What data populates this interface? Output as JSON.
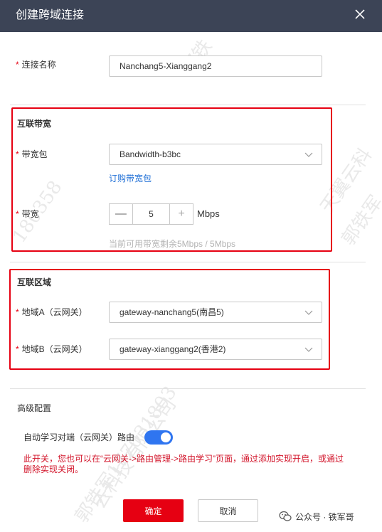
{
  "dialog": {
    "title": "创建跨域连接"
  },
  "connection_name": {
    "label": "连接名称",
    "value": "Nanchang5-Xianggang2"
  },
  "bandwidth_section": {
    "title": "互联带宽",
    "package_label": "带宽包",
    "package_value": "Bandwidth-b3bc",
    "buy_link": "订购带宽包",
    "bandwidth_label": "带宽",
    "minus": "—",
    "plus": "+",
    "bandwidth_value": "5",
    "unit": "Mbps",
    "available_hint": "当前可用带宽剩余5Mbps / 5Mbps"
  },
  "region_section": {
    "title": "互联区域",
    "region_a_label": "地域A（云网关）",
    "region_a_value": "gateway-nanchang5(南昌5)",
    "region_b_label": "地域B（云网关）",
    "region_b_value": "gateway-xianggang2(香港2)"
  },
  "advanced": {
    "title": "高级配置",
    "auto_learn_label": "自动学习对端（云网关）路由",
    "toggle_on": true,
    "warning_line1": "此开关，您也可以在“云网关->路由管理->路由学习”页面，通过添加实现开启，或通过",
    "warning_line2": "删除实现关闭。"
  },
  "footer": {
    "confirm": "确定",
    "cancel": "取消"
  },
  "wechat_label": "公众号 · 铁军哥",
  "colors": {
    "header_bg": "#3c4456",
    "accent_red": "#e60012",
    "toggle_blue": "#2f75f0",
    "link_blue": "#1f6fd6"
  }
}
